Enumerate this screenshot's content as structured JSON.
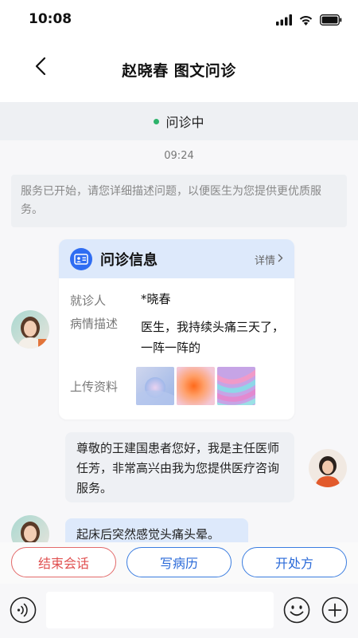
{
  "status_bar": {
    "time": "10:08"
  },
  "nav": {
    "title": "赵晓春 图文问诊"
  },
  "consult_status": {
    "label": "问诊中",
    "dot_color": "#2db36b"
  },
  "chat": {
    "timestamp": "09:24",
    "system_message": "服务已开始，请您详细描述问题，以便医生为您提供更优质服务。",
    "card": {
      "title": "问诊信息",
      "detail_link": "详情",
      "patient_label": "就诊人",
      "patient_value": "*晓春",
      "condition_label": "病情描述",
      "condition_value": "医生，我持续头痛三天了，一阵一阵的",
      "uploads_label": "上传资料"
    },
    "doctor_message": "尊敬的王建国患者您好，我是主任医师任芳，非常高兴由我为您提供医疗咨询服务。",
    "patient_message": "起床后突然感觉头痛头晕。"
  },
  "actions": {
    "end_session": "结束会话",
    "write_record": "写病历",
    "prescribe": "开处方"
  },
  "input": {
    "placeholder": ""
  },
  "colors": {
    "accent": "#2f6df2",
    "danger": "#e05050",
    "card_header": "#dde9fb"
  },
  "icons": [
    "back-arrow-icon",
    "signal-icon",
    "wifi-icon",
    "battery-icon",
    "id-card-icon",
    "chevron-right-icon",
    "voice-icon",
    "emoji-icon",
    "plus-icon"
  ]
}
